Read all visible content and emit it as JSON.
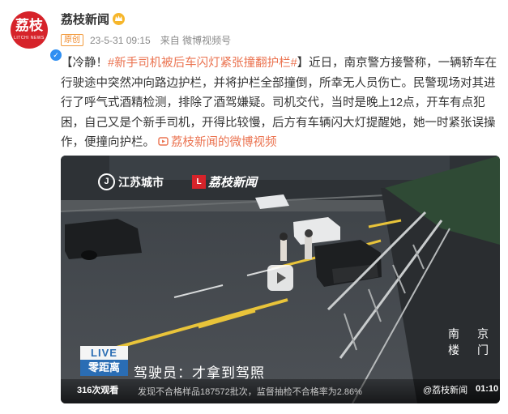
{
  "account": {
    "name": "荔枝新闻",
    "avatar_text": "荔枝",
    "avatar_sub": "LITCHI NEWS",
    "badge": "原创",
    "date": "23-5-31 09:15",
    "source": "来自 微博视频号"
  },
  "post": {
    "lead": "【冷静！",
    "hashtag": "#新手司机被后车闪灯紧张撞翻护栏#",
    "body": "】近日，南京警方接警称，一辆轿车在行驶途中突然冲向路边护栏，并将护栏全部撞倒，所幸无人员伤亡。民警现场对其进行了呼气式酒精检测，排除了酒驾嫌疑。司机交代，当时是晚上12点，开车有点犯困，自己又是个新手司机，开得比较慢，后方有车辆闪大灯提醒她，她一时紧张误操作，便撞向护栏。",
    "link_text": "荔枝新闻的微博视频"
  },
  "video": {
    "watermark_left": "江苏城市",
    "watermark_right": "荔枝新闻",
    "city_label": "南京楼门",
    "live_label": "LIVE",
    "station_label": "零距离",
    "caption": "驾驶员：才拿到驾照",
    "ticker": "发现不合格样品187572批次，监督抽检不合格率为2.86%",
    "views": "316次观看",
    "bottom_watermark": "@荔枝新闻",
    "duration": "01:10"
  },
  "colors": {
    "accent": "#eb7350",
    "brand": "#d6232a",
    "verified": "#2f8ff2",
    "badge": "#f08a2b"
  },
  "icons": [
    "verified-icon",
    "crown-icon",
    "video-link-icon",
    "play-icon"
  ]
}
